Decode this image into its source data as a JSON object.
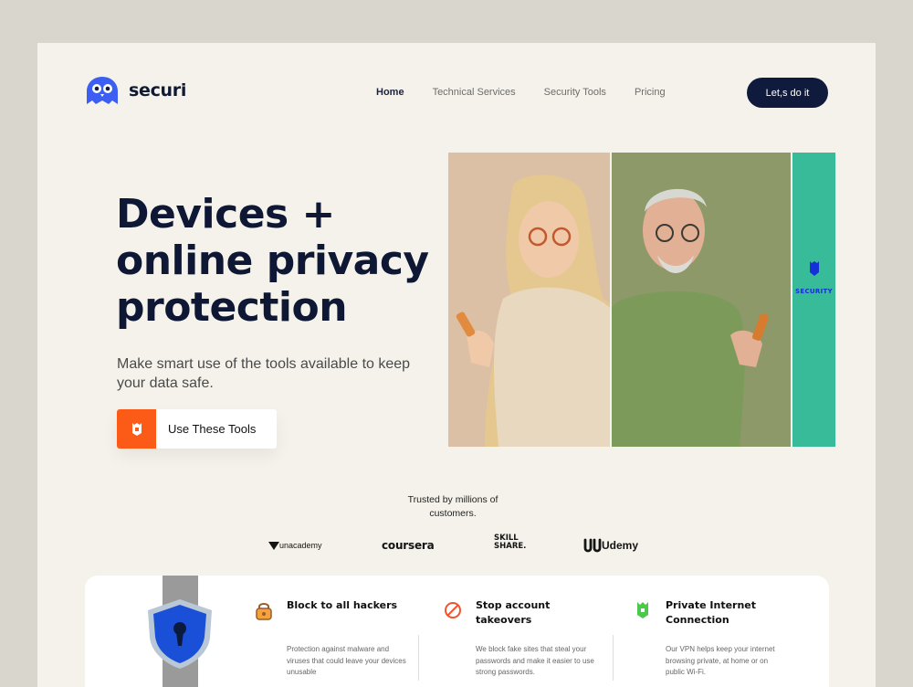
{
  "brand": {
    "name": "securi",
    "accent": "#fb5a17",
    "navy": "#0f1a3c",
    "teal": "#38bb98"
  },
  "nav": {
    "items": [
      {
        "label": "Home",
        "active": true
      },
      {
        "label": "Technical Services",
        "active": false
      },
      {
        "label": "Security Tools",
        "active": false
      },
      {
        "label": "Pricing",
        "active": false
      }
    ],
    "cta": "Let,s do it"
  },
  "hero": {
    "title_lines": [
      "Devices +",
      "online privacy",
      "protection"
    ],
    "subtitle": "Make smart use of the tools available to keep your data safe.",
    "button_label": "Use These Tools"
  },
  "side_panel": {
    "label": "SECURITY"
  },
  "trusted": {
    "text": "Trusted by millions of customers.",
    "logos": {
      "unacademy": "unacademy",
      "coursera": "coursera",
      "skill_line1": "SKILL",
      "skill_line2": "SHARE.",
      "udemy": "Udemy"
    }
  },
  "features": [
    {
      "title": "Block to all hackers",
      "description": "Protection against malware and viruses that could leave your devices unusable",
      "icon": "lock-icon"
    },
    {
      "title": "Stop account takeovers",
      "description": "We block fake sites that steal your passwords and make it easier to use strong passwords.",
      "icon": "block-icon"
    },
    {
      "title": "Private Internet Connection",
      "description": "Our VPN helps keep your internet browsing private, at home or on public Wi-Fi.",
      "icon": "vpn-icon"
    }
  ]
}
